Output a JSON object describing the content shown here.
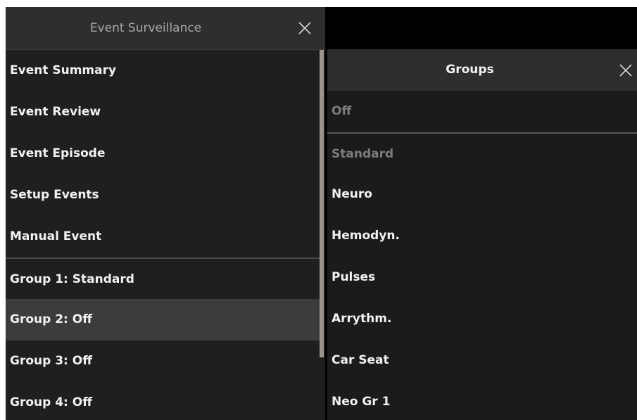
{
  "left_panel": {
    "title": "Event Surveillance",
    "items": [
      {
        "label": "Event Summary"
      },
      {
        "label": "Event Review"
      },
      {
        "label": "Event Episode"
      },
      {
        "label": "Setup Events"
      },
      {
        "label": "Manual Event"
      },
      {
        "label": "Group 1: Standard"
      },
      {
        "label": "Group 2: Off"
      },
      {
        "label": "Group 3: Off"
      },
      {
        "label": "Group 4: Off"
      }
    ],
    "selected_item": "Group 2: Off"
  },
  "right_panel": {
    "title": "Groups",
    "items": [
      {
        "label": "Off",
        "state": "disabled"
      },
      {
        "label": "Standard",
        "state": "disabled"
      },
      {
        "label": "Neuro",
        "state": "enabled"
      },
      {
        "label": "Hemodyn.",
        "state": "enabled"
      },
      {
        "label": "Pulses",
        "state": "enabled"
      },
      {
        "label": "Arrythm.",
        "state": "enabled"
      },
      {
        "label": "Car Seat",
        "state": "enabled"
      },
      {
        "label": "Neo Gr 1",
        "state": "enabled"
      }
    ]
  },
  "icons": {
    "close": "close-icon"
  },
  "colors": {
    "header_bg": "#2e2e2e",
    "panel_bg": "#1f1f1f",
    "selected_bg": "#3c3c3c",
    "text": "#f2f2f2",
    "disabled_text": "#7c7c7c",
    "scrollbar": "#9a948d"
  }
}
